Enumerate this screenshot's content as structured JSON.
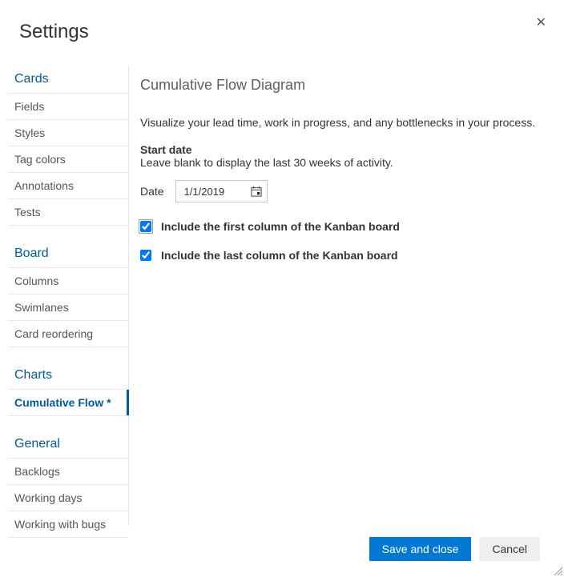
{
  "dialog_title": "Settings",
  "close_icon": "✕",
  "sidebar": {
    "sections": {
      "cards": {
        "header": "Cards",
        "items": [
          "Fields",
          "Styles",
          "Tag colors",
          "Annotations",
          "Tests"
        ]
      },
      "board": {
        "header": "Board",
        "items": [
          "Columns",
          "Swimlanes",
          "Card reordering"
        ]
      },
      "charts": {
        "header": "Charts",
        "items": [
          "Cumulative Flow *"
        ]
      },
      "general": {
        "header": "General",
        "items": [
          "Backlogs",
          "Working days",
          "Working with bugs"
        ]
      }
    }
  },
  "panel": {
    "title": "Cumulative Flow Diagram",
    "description": "Visualize your lead time, work in progress, and any bottlenecks in your process.",
    "start_date_label": "Start date",
    "start_date_hint": "Leave blank to display the last 30 weeks of activity.",
    "date_label": "Date",
    "date_value": "1/1/2019",
    "checkbox_first": "Include the first column of the Kanban board",
    "checkbox_last": "Include the last column of the Kanban board"
  },
  "footer": {
    "save": "Save and close",
    "cancel": "Cancel"
  }
}
